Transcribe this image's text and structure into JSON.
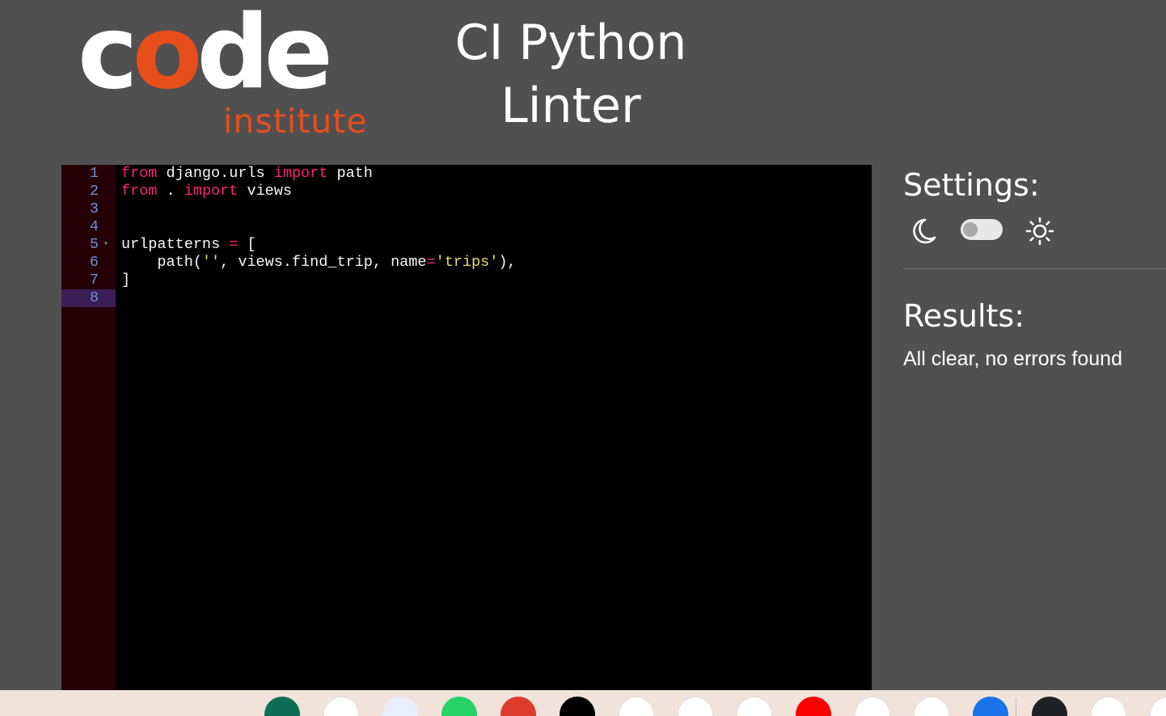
{
  "header": {
    "logo_word": "code",
    "logo_sub": "institute",
    "title_line1": "CI Python",
    "title_line2": "Linter"
  },
  "editor": {
    "active_line": 8,
    "lines": [
      {
        "n": "1",
        "code": "from django.urls import path"
      },
      {
        "n": "2",
        "code": "from . import views"
      },
      {
        "n": "3",
        "code": ""
      },
      {
        "n": "4",
        "code": ""
      },
      {
        "n": "5",
        "code": "urlpatterns = ["
      },
      {
        "n": "6",
        "code": "    path('', views.find_trip, name='trips'),"
      },
      {
        "n": "7",
        "code": "]"
      },
      {
        "n": "8",
        "code": ""
      }
    ]
  },
  "settings": {
    "heading": "Settings:",
    "moon_icon": "moon-icon",
    "sun_icon": "sun-icon",
    "theme_toggle_on": false
  },
  "results": {
    "heading": "Results:",
    "message": "All clear, no errors found"
  },
  "taskbar": {
    "apps": [
      {
        "name": "meet-icon",
        "color": "#0d6e54"
      },
      {
        "name": "gemini-icon",
        "color": "#ffffff"
      },
      {
        "name": "translate-icon",
        "color": "#e8eefb"
      },
      {
        "name": "whatsapp-icon",
        "color": "#25d366"
      },
      {
        "name": "chrome-icon",
        "color": "#dd3b2e"
      },
      {
        "name": "threads-icon",
        "color": "#000000"
      },
      {
        "name": "photos-icon",
        "color": "#ffffff"
      },
      {
        "name": "calendar-icon",
        "color": "#ffffff"
      },
      {
        "name": "youtube-icon",
        "color": "#ffffff"
      },
      {
        "name": "youtube-music-icon",
        "color": "#ff0000"
      },
      {
        "name": "gmail-icon",
        "color": "#ffffff"
      },
      {
        "name": "vscode-icon",
        "color": "#ffffff"
      },
      {
        "name": "files-icon",
        "color": "#1a73e8"
      },
      {
        "name": "docs-icon",
        "color": "#202124"
      },
      {
        "name": "queue-icon",
        "color": "#ffffff"
      },
      {
        "name": "app-icon",
        "color": "#ffffff"
      }
    ]
  }
}
